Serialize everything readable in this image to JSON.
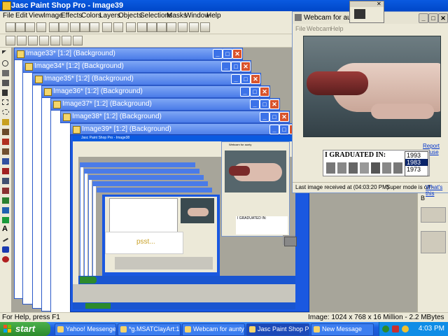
{
  "app": {
    "title": "Jasc Paint Shop Pro - Image39"
  },
  "menu": [
    "File",
    "Edit",
    "View",
    "Image",
    "Effects",
    "Colors",
    "Layers",
    "Objects",
    "Selections",
    "Masks",
    "Window",
    "Help"
  ],
  "image_windows": [
    "Image33* [1:2] (Background)",
    "Image34* [1:2] (Background)",
    "Image35* [1:2] (Background)",
    "Image36* [1:2] (Background)",
    "Image37* [1:2] (Background)",
    "Image38* [1:2] (Background)",
    "Image39* [1:2] (Background)"
  ],
  "window_buttons": {
    "minimize": "_",
    "maximize": "□",
    "close": "✕"
  },
  "webcam": {
    "title": "Webcam for aunty",
    "menu": [
      "File",
      "Webcam",
      "Help"
    ],
    "report": "Report Abuse",
    "graduated_label": "I GRADUATED IN:",
    "years": [
      "1993",
      "1983",
      "1973"
    ],
    "selected_year": "1983",
    "last_image": "Last image received at (04:03:20 PM)",
    "super_mode": "Super mode is off -",
    "whats_this": "What's this"
  },
  "inner_screenshot": {
    "title": "Jasc Paint Shop Pro - Image38",
    "psst": "psst...",
    "webcam_title": "Webcam for aunty",
    "graduated_label": "I GRADUATED IN:"
  },
  "right_panel": {
    "line1": "V",
    "line2": "B"
  },
  "status": {
    "help": "For Help, press F1",
    "image_info": "Image:  1024 x 768 x 16 Million - 2.2 MBytes"
  },
  "taskbar": {
    "start": "start",
    "tasks": [
      "Yahoo! Messenger ...",
      "*g.MSATClayArt:1 ...",
      "Webcam for aunty...",
      "Jasc Paint Shop Pro...",
      "New Message"
    ],
    "active_task": "Jasc Paint Shop Pro...",
    "clock": "4:03 PM"
  },
  "colors": {
    "xp_blue": "#0a5ae0",
    "start_green": "#2c8a2c",
    "close_red": "#d9532b"
  }
}
